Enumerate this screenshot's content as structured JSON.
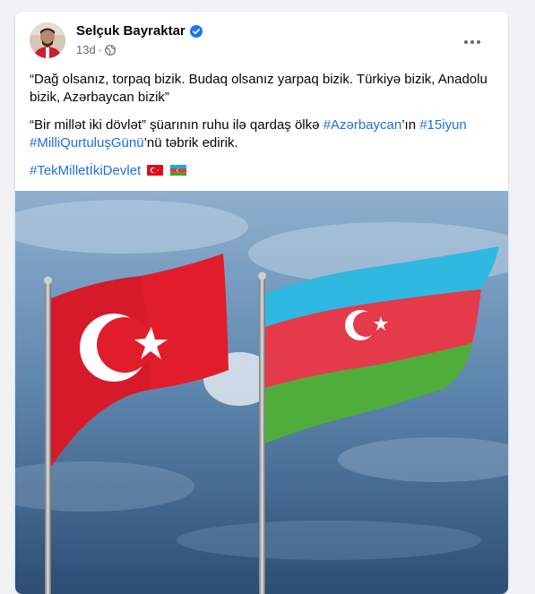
{
  "post": {
    "author_name": "Selçuk Bayraktar",
    "time": "13d",
    "separator": "·",
    "paragraph1": "“Dağ olsanız, torpaq bizik. Budaq olsanız yarpaq bizik. Türkiyə bizik, Anadolu bizik, Azərbaycan bizik”",
    "p2_text1": "“Bir millət iki dövlət” şüarının ruhu ilə qardaş ölkə ",
    "p2_tag1": "#Azərbaycan",
    "p2_text2": "’ın ",
    "p2_tag2": "#15iyun",
    "p2_text3": " ",
    "p2_tag3": "#MilliQurtuluşGünü",
    "p2_text4": "’nü təbrik edirik.",
    "p3_tag": "#TekMilletİkiDevlet",
    "icons": {
      "verified": "verified-badge-icon",
      "audience": "globe-icon",
      "more": "more-options-icon",
      "flag_tr": "turkey-flag-emoji",
      "flag_az": "azerbaijan-flag-emoji"
    }
  },
  "colors": {
    "hashtag": "#216fdb",
    "verified": "#1877f2",
    "turkey_red": "#e30a17",
    "az_blue": "#00b5e2",
    "az_red": "#ef3340",
    "az_green": "#509e2f"
  }
}
